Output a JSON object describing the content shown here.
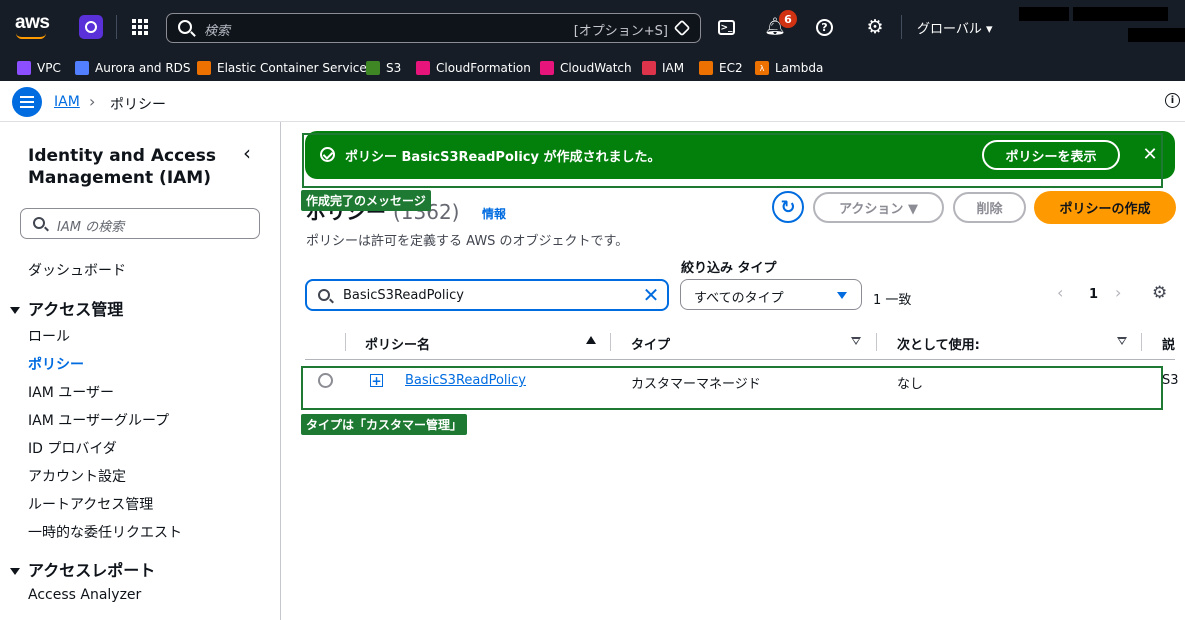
{
  "topnav": {
    "logo": "aws",
    "search_placeholder": "検索",
    "search_shortcut": "[オプション+S]",
    "notification_count": "6",
    "region": "グローバル ▾"
  },
  "bookmarks": [
    {
      "label": "VPC",
      "color": "#8c4fff"
    },
    {
      "label": "Aurora and RDS",
      "color": "#527fff"
    },
    {
      "label": "Elastic Container Service",
      "color": "#ed7100"
    },
    {
      "label": "S3",
      "color": "#3f8624"
    },
    {
      "label": "CloudFormation",
      "color": "#e7157b"
    },
    {
      "label": "CloudWatch",
      "color": "#e7157b"
    },
    {
      "label": "IAM",
      "color": "#dd344c"
    },
    {
      "label": "EC2",
      "color": "#ed7100"
    },
    {
      "label": "Lambda",
      "color": "#ed7100"
    }
  ],
  "breadcrumb": {
    "root": "IAM",
    "current": "ポリシー"
  },
  "sidebar": {
    "title": "Identity and Access Management (IAM)",
    "search_placeholder": "IAM の検索",
    "dashboard": "ダッシュボード",
    "section_access_mgmt": "アクセス管理",
    "items": [
      "ロール",
      "ポリシー",
      "IAM ユーザー",
      "IAM ユーザーグループ",
      "ID プロバイダ",
      "アカウント設定",
      "ルートアクセス管理",
      "一時的な委任リクエスト"
    ],
    "section_access_reports": "アクセスレポート",
    "access_analyzer": "Access Analyzer"
  },
  "flash": {
    "message": "ポリシー BasicS3ReadPolicy が作成されました。",
    "view_button": "ポリシーを表示"
  },
  "annotations": {
    "flash_label": "作成完了のメッセージ",
    "row_label": "タイプは「カスタマー管理」"
  },
  "header": {
    "title": "ポリシー",
    "count": "(1362)",
    "info": "情報",
    "description": "ポリシーは許可を定義する AWS のオブジェクトです。",
    "actions_button": "アクション ▼",
    "delete_button": "削除",
    "create_button": "ポリシーの作成"
  },
  "filter": {
    "search_value": "BasicS3ReadPolicy",
    "type_label": "絞り込み タイプ",
    "type_value": "すべてのタイプ",
    "match_count": "1 一致",
    "page": "1"
  },
  "table": {
    "columns": [
      "ポリシー名",
      "タイプ",
      "次として使用:",
      "説"
    ],
    "rows": [
      {
        "name": "BasicS3ReadPolicy",
        "type": "カスタマーマネージド",
        "used_as": "なし",
        "desc": "S3"
      }
    ]
  },
  "colors": {
    "accent": "#006ce0",
    "success": "#037f0c",
    "primary_button": "#ff9900",
    "annotation": "#1e7a32"
  }
}
